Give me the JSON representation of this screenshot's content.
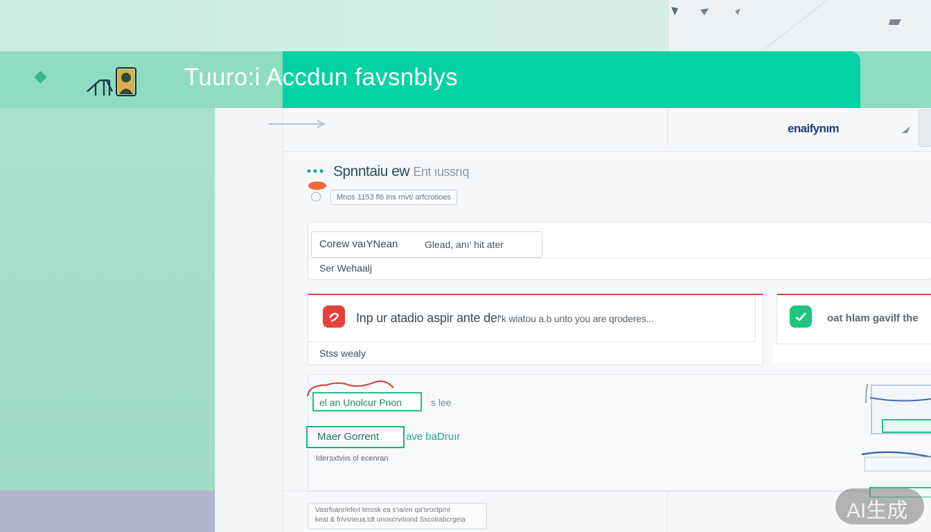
{
  "header": {
    "title": "Tuuro:i Accdun favsnblys"
  },
  "topbar": {
    "account_name": "enaifynım"
  },
  "section": {
    "title": "Spnntaiu ew",
    "title_light": "Ent ıussrıq",
    "subtitle": "Mnos 1153 fl6 Ins rnvt/ arfcrotioes"
  },
  "form": {
    "input_value": "Corew vaıYNean",
    "input_hint": "Glead, anı' hit ater",
    "link_label": "Ser Wehaalj"
  },
  "alerts": {
    "error_text": "Inp ur atadio aspir ante de",
    "error_text_small": "f'k wiatou a.b unto  you are qroderes...",
    "error_footer": "Stss  wealy",
    "success_text": "oat hlam gavilf the"
  },
  "lower": {
    "button_1_label": "el an  Unolcur Pnon",
    "button_1_side": "s lee",
    "button_2_label": "Maer  Gorrent",
    "button_2_side": "ave baDruır",
    "caption": "Ideraxtviıs ol ecenran"
  },
  "footer_note": {
    "line_1": "Vasrfoanr/efeıt  terosk ea s'ıa/en qa'sroctp/nr",
    "line_2": "keat & fr/vsneua.tdt  onoscrvitiond Sscolrabcrgeia"
  },
  "watermark": {
    "text": "AI生成"
  },
  "colors": {
    "accent": "#07d2a3",
    "header_band": "#8fdcc2",
    "error": "#e5403b",
    "success": "#1ec57e",
    "account_text": "#1f3d72"
  }
}
